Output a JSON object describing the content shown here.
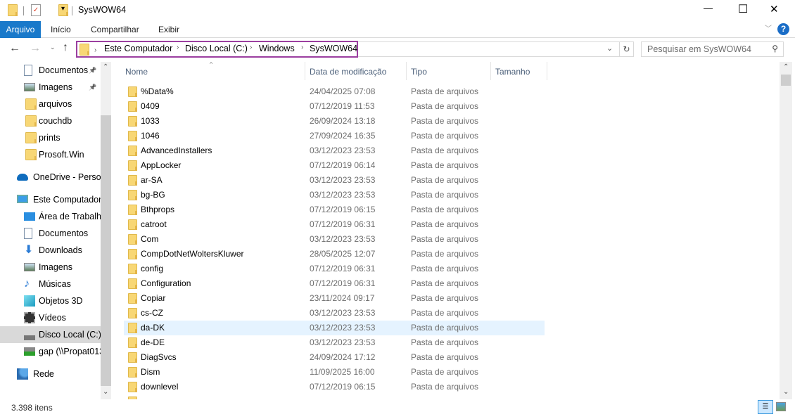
{
  "window": {
    "title": "SysWOW64",
    "minimize": "—",
    "maximize": "☐",
    "close": "✕"
  },
  "ribbon": {
    "tabs": [
      "Arquivo",
      "Início",
      "Compartilhar",
      "Exibir"
    ],
    "help": "?"
  },
  "address": {
    "breadcrumbs": [
      "Este Computador",
      "Disco Local (C:)",
      "Windows",
      "SysWOW64"
    ],
    "search_placeholder": "Pesquisar em SysWOW64",
    "highlight_color": "#9b3fa0"
  },
  "nav": {
    "items": [
      {
        "label": "Documentos",
        "icon": "documents-icon",
        "pinned": true
      },
      {
        "label": "Imagens",
        "icon": "pictures-icon",
        "pinned": true
      },
      {
        "label": "arquivos",
        "icon": "folder-icon"
      },
      {
        "label": "couchdb",
        "icon": "folder-icon"
      },
      {
        "label": "prints",
        "icon": "folder-icon"
      },
      {
        "label": "Prosoft.Win",
        "icon": "folder-icon"
      },
      {
        "label": "OneDrive - Persor",
        "icon": "onedrive-icon"
      },
      {
        "label": "Este Computador",
        "icon": "computer-icon"
      },
      {
        "label": "Área de Trabalho",
        "icon": "desktop-icon"
      },
      {
        "label": "Documentos",
        "icon": "documents-icon"
      },
      {
        "label": "Downloads",
        "icon": "downloads-icon"
      },
      {
        "label": "Imagens",
        "icon": "pictures-icon"
      },
      {
        "label": "Músicas",
        "icon": "music-icon"
      },
      {
        "label": "Objetos 3D",
        "icon": "objects3d-icon"
      },
      {
        "label": "Vídeos",
        "icon": "videos-icon"
      },
      {
        "label": "Disco Local (C:)",
        "icon": "drive-icon",
        "selected": true
      },
      {
        "label": "gap (\\\\Propat013",
        "icon": "network-drive-icon"
      },
      {
        "label": "Rede",
        "icon": "network-icon"
      }
    ]
  },
  "list": {
    "columns": [
      "Nome",
      "Data de modificação",
      "Tipo",
      "Tamanho"
    ],
    "rows": [
      [
        "%Data%",
        "24/04/2025 07:08",
        "Pasta de arquivos"
      ],
      [
        "0409",
        "07/12/2019 11:53",
        "Pasta de arquivos"
      ],
      [
        "1033",
        "26/09/2024 13:18",
        "Pasta de arquivos"
      ],
      [
        "1046",
        "27/09/2024 16:35",
        "Pasta de arquivos"
      ],
      [
        "AdvancedInstallers",
        "03/12/2023 23:53",
        "Pasta de arquivos"
      ],
      [
        "AppLocker",
        "07/12/2019 06:14",
        "Pasta de arquivos"
      ],
      [
        "ar-SA",
        "03/12/2023 23:53",
        "Pasta de arquivos"
      ],
      [
        "bg-BG",
        "03/12/2023 23:53",
        "Pasta de arquivos"
      ],
      [
        "Bthprops",
        "07/12/2019 06:15",
        "Pasta de arquivos"
      ],
      [
        "catroot",
        "07/12/2019 06:31",
        "Pasta de arquivos"
      ],
      [
        "Com",
        "03/12/2023 23:53",
        "Pasta de arquivos"
      ],
      [
        "CompDotNetWoltersKluwer",
        "28/05/2025 12:07",
        "Pasta de arquivos"
      ],
      [
        "config",
        "07/12/2019 06:31",
        "Pasta de arquivos"
      ],
      [
        "Configuration",
        "07/12/2019 06:31",
        "Pasta de arquivos"
      ],
      [
        "Copiar",
        "23/11/2024 09:17",
        "Pasta de arquivos"
      ],
      [
        "cs-CZ",
        "03/12/2023 23:53",
        "Pasta de arquivos"
      ],
      [
        "da-DK",
        "03/12/2023 23:53",
        "Pasta de arquivos"
      ],
      [
        "de-DE",
        "03/12/2023 23:53",
        "Pasta de arquivos"
      ],
      [
        "DiagSvcs",
        "24/09/2024 17:12",
        "Pasta de arquivos"
      ],
      [
        "Dism",
        "11/09/2025 16:00",
        "Pasta de arquivos"
      ],
      [
        "downlevel",
        "07/12/2019 06:15",
        "Pasta de arquivos"
      ]
    ],
    "hovered_index": 16
  },
  "status": {
    "count": "3.398 itens"
  }
}
